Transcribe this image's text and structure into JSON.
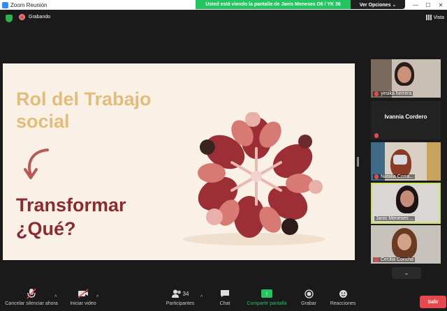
{
  "window": {
    "title": "Zoom Reunión",
    "minimize": "—",
    "maximize": "☐",
    "close": "✕"
  },
  "share_banner": {
    "message": "Usted está viendo la pantalla de  Janis Meneses D6 / YK 36",
    "options_label": "Ver Opciones ⌄"
  },
  "status": {
    "recording_label": "Grabando",
    "view_label": "Vista"
  },
  "slide": {
    "heading": "Rol del Trabajo social",
    "subheading_line1": "Transformar",
    "subheading_line2": "¿Qué?",
    "colors": {
      "heading": "#e3bc7c",
      "subheading": "#8c2a2e",
      "background": "#f9f1e6"
    }
  },
  "gallery": {
    "participants": [
      {
        "name": "yesika herrera",
        "muted": true
      },
      {
        "name": "Ivannia Cordero",
        "muted": true
      },
      {
        "name": "Natalia Corra...",
        "muted": true
      },
      {
        "name": "Janis Meneses ...",
        "muted": false,
        "active": true
      },
      {
        "name": "Cecilia Concha",
        "muted": true
      }
    ],
    "more_icon": "chevron-down-icon"
  },
  "toolbar": {
    "mute_label": "Cancelar silenciar ahora",
    "video_label": "Iniciar video",
    "participants_label": "Participantes",
    "participants_count": "34",
    "chat_label": "Chat",
    "share_label": "Compartir pantalla",
    "record_label": "Grabar",
    "reactions_label": "Reacciones",
    "leave_label": "Salir"
  }
}
